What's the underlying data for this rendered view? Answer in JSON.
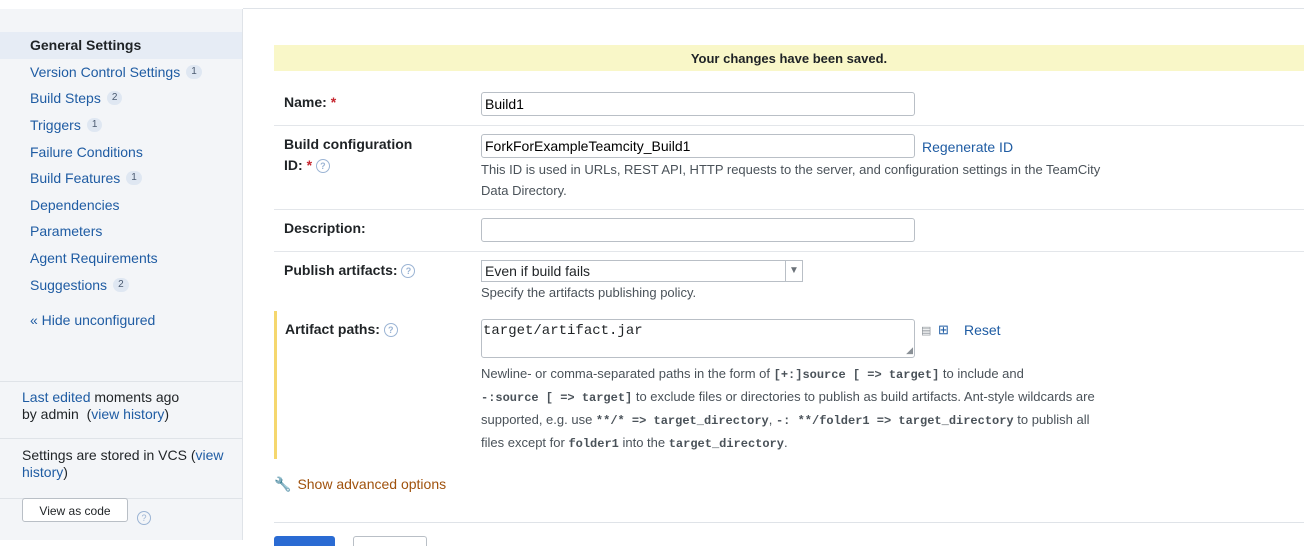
{
  "sidebar": {
    "items": [
      {
        "label": "General Settings",
        "badge": ""
      },
      {
        "label": "Version Control Settings",
        "badge": "1"
      },
      {
        "label": "Build Steps",
        "badge": "2"
      },
      {
        "label": "Triggers",
        "badge": "1"
      },
      {
        "label": "Failure Conditions",
        "badge": ""
      },
      {
        "label": "Build Features",
        "badge": "1"
      },
      {
        "label": "Dependencies",
        "badge": ""
      },
      {
        "label": "Parameters",
        "badge": ""
      },
      {
        "label": "Agent Requirements",
        "badge": ""
      },
      {
        "label": "Suggestions",
        "badge": "2"
      }
    ],
    "hide_link": "« Hide unconfigured",
    "last_edited_link": "Last edited",
    "last_edited_text": " moments ago",
    "by_admin": "by admin",
    "view_history": "view history",
    "vcs_text": "Settings are stored in VCS (",
    "vcs_view": "view",
    "vcs_history": "history",
    "vcs_close": ")",
    "view_as_code": "View as code"
  },
  "banner": "Your changes have been saved.",
  "form": {
    "name_label": "Name:",
    "name_value": "Build1",
    "id_label_1": "Build configuration",
    "id_label_2": "ID:",
    "id_value": "ForkForExampleTeamcity_Build1",
    "regenerate": "Regenerate ID",
    "id_note_1": "This ID is used in URLs, REST API, HTTP requests to the server, and configuration settings in the TeamCity",
    "id_note_2": "Data Directory.",
    "desc_label": "Description:",
    "desc_value": "",
    "publish_label": "Publish artifacts:",
    "publish_value": "Even if build fails",
    "publish_note": "Specify the artifacts publishing policy.",
    "artifact_label": "Artifact paths:",
    "artifact_value": "target/artifact.jar",
    "reset": "Reset",
    "art_note": {
      "l1a": "Newline- or comma-separated paths in the form of ",
      "l1b": "[+:]source [ => target]",
      "l1c": " to include and",
      "l2a": "-:source [ => target]",
      "l2b": " to exclude files or directories to publish as build artifacts. Ant-style wildcards are",
      "l3a": "supported, e.g. use ",
      "l3b": "**/* => target_directory",
      "l3c": ", ",
      "l3d": "-: **/folder1 => target_directory",
      "l3e": " to publish all",
      "l4a": "files except for ",
      "l4b": "folder1",
      "l4c": " into the ",
      "l4d": "target_directory",
      "l4e": "."
    },
    "advanced": "Show advanced options",
    "required_mark": "*",
    "help_glyph": "?"
  }
}
